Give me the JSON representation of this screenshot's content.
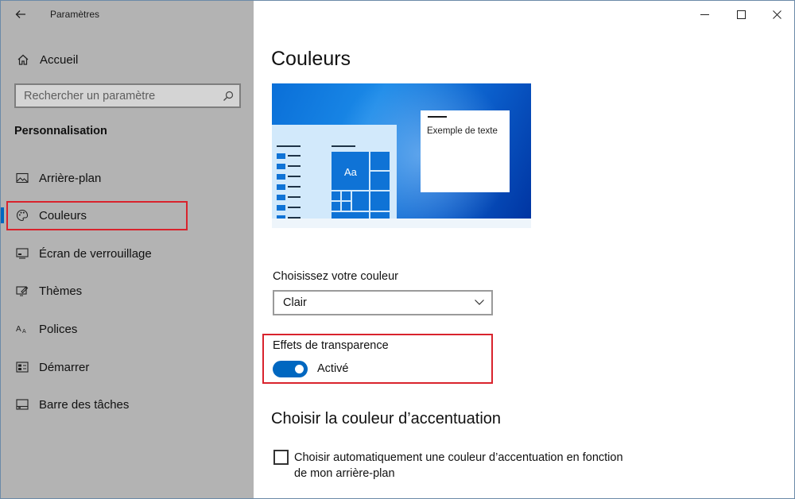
{
  "window": {
    "title": "Paramètres"
  },
  "sidebar": {
    "home_label": "Accueil",
    "search_placeholder": "Rechercher un paramètre",
    "section_title": "Personnalisation",
    "items": [
      {
        "label": "Arrière-plan",
        "icon": "picture-icon"
      },
      {
        "label": "Couleurs",
        "icon": "palette-icon",
        "selected": true
      },
      {
        "label": "Écran de verrouillage",
        "icon": "lock-screen-icon"
      },
      {
        "label": "Thèmes",
        "icon": "themes-icon"
      },
      {
        "label": "Polices",
        "icon": "fonts-icon"
      },
      {
        "label": "Démarrer",
        "icon": "start-icon"
      },
      {
        "label": "Barre des tâches",
        "icon": "taskbar-icon"
      }
    ]
  },
  "main": {
    "title": "Couleurs",
    "preview": {
      "tile_label": "Aa",
      "sample_text": "Exemple de texte"
    },
    "choose_color_label": "Choisissez votre couleur",
    "choose_color_value": "Clair",
    "transparency_label": "Effets de transparence",
    "transparency_state": "Activé",
    "transparency_on": true,
    "accent_heading": "Choisir la couleur d’accentuation",
    "auto_accent_label": "Choisir automatiquement une couleur d’accentuation en fonction de mon arrière-plan",
    "auto_accent_checked": false
  },
  "colors": {
    "sidebar_bg": "#b3b3b3",
    "accent": "#0067c0",
    "highlight_box": "#d9232d"
  }
}
